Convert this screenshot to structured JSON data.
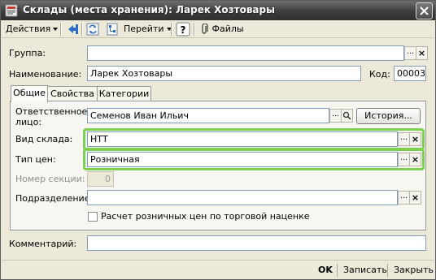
{
  "window": {
    "title": "Склады (места хранения): Ларек Хозтовары"
  },
  "toolbar": {
    "actions_label": "Действия",
    "goto_label": "Перейти",
    "files_label": "Файлы"
  },
  "form": {
    "group_label": "Группа:",
    "group_value": "",
    "name_label": "Наименование:",
    "name_value": "Ларек Хозтовары",
    "code_label": "Код:",
    "code_value": "00003"
  },
  "tabs": [
    {
      "label": "Общие",
      "active": true
    },
    {
      "label": "Свойства",
      "active": false
    },
    {
      "label": "Категории",
      "active": false
    }
  ],
  "general": {
    "responsible_label": "Ответственное лицо:",
    "responsible_value": "Семенов Иван Ильич",
    "history_label": "История...",
    "warehouse_type_label": "Вид склада:",
    "warehouse_type_value": "НТТ",
    "price_type_label": "Тип цен:",
    "price_type_value": "Розничная",
    "section_label": "Номер секции:",
    "section_value": "0",
    "department_label": "Подразделение:",
    "department_value": "",
    "retail_calc_label": "Расчет розничных цен по торговой наценке",
    "retail_calc_checked": false
  },
  "comment": {
    "label": "Комментарий:",
    "value": ""
  },
  "bottom": {
    "ok_label": "OK",
    "save_label": "Записать",
    "close_label": "Закрыть"
  },
  "colors": {
    "highlight": "#7bd14d",
    "titlebar": "#3c3c3c",
    "field_border": "#7f9db9"
  }
}
